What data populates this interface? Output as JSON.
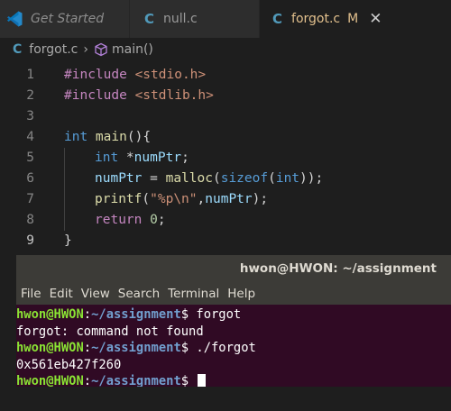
{
  "tabs": [
    {
      "label": "Get Started",
      "icon": "vscode-logo-icon"
    },
    {
      "label": "null.c",
      "icon": "c-file-icon"
    },
    {
      "label": "forgot.c",
      "icon": "c-file-icon",
      "modified": "M",
      "close": "✕"
    }
  ],
  "breadcrumb": {
    "file": "forgot.c",
    "symbol": "main()",
    "separator": "›"
  },
  "editor": {
    "line_numbers": [
      "1",
      "2",
      "3",
      "4",
      "5",
      "6",
      "7",
      "8",
      "9"
    ],
    "lines": {
      "l1_kw": "#include",
      "l1_hdr": " <stdio.h>",
      "l2_kw": "#include",
      "l2_hdr": " <stdlib.h>",
      "l4_type": "int",
      "l4_fn": " main",
      "l4_rest": "(){",
      "l5_type": "int",
      "l5_rest": " *",
      "l5_var": "numPtr",
      "l5_end": ";",
      "l6_var": "numPtr",
      "l6_eq": " = ",
      "l6_fn": "malloc",
      "l6_p1": "(",
      "l6_kw": "sizeof",
      "l6_p2": "(",
      "l6_type": "int",
      "l6_p3": "));",
      "l7_fn": "printf",
      "l7_p1": "(",
      "l7_str": "\"%p\\n\"",
      "l7_comma": ",",
      "l7_var": "numPtr",
      "l7_end": ");",
      "l8_kw": "return",
      "l8_sp": " ",
      "l8_num": "0",
      "l8_end": ";",
      "l9": "}"
    }
  },
  "terminal": {
    "title": "hwon@HWON: ~/assignment",
    "menu": [
      "File",
      "Edit",
      "View",
      "Search",
      "Terminal",
      "Help"
    ],
    "user_host": "hwon@HWON",
    "colon": ":",
    "path": "~/assignment",
    "prompt_sign": "$",
    "cmd1": " forgot",
    "out1": "forgot: command not found",
    "cmd2": " ./forgot",
    "out2": "0x561eb427f260"
  },
  "colors": {
    "accent_c_icon": "#519aba",
    "modified_tab": "#e2c08d",
    "terminal_bg": "#300a24"
  }
}
